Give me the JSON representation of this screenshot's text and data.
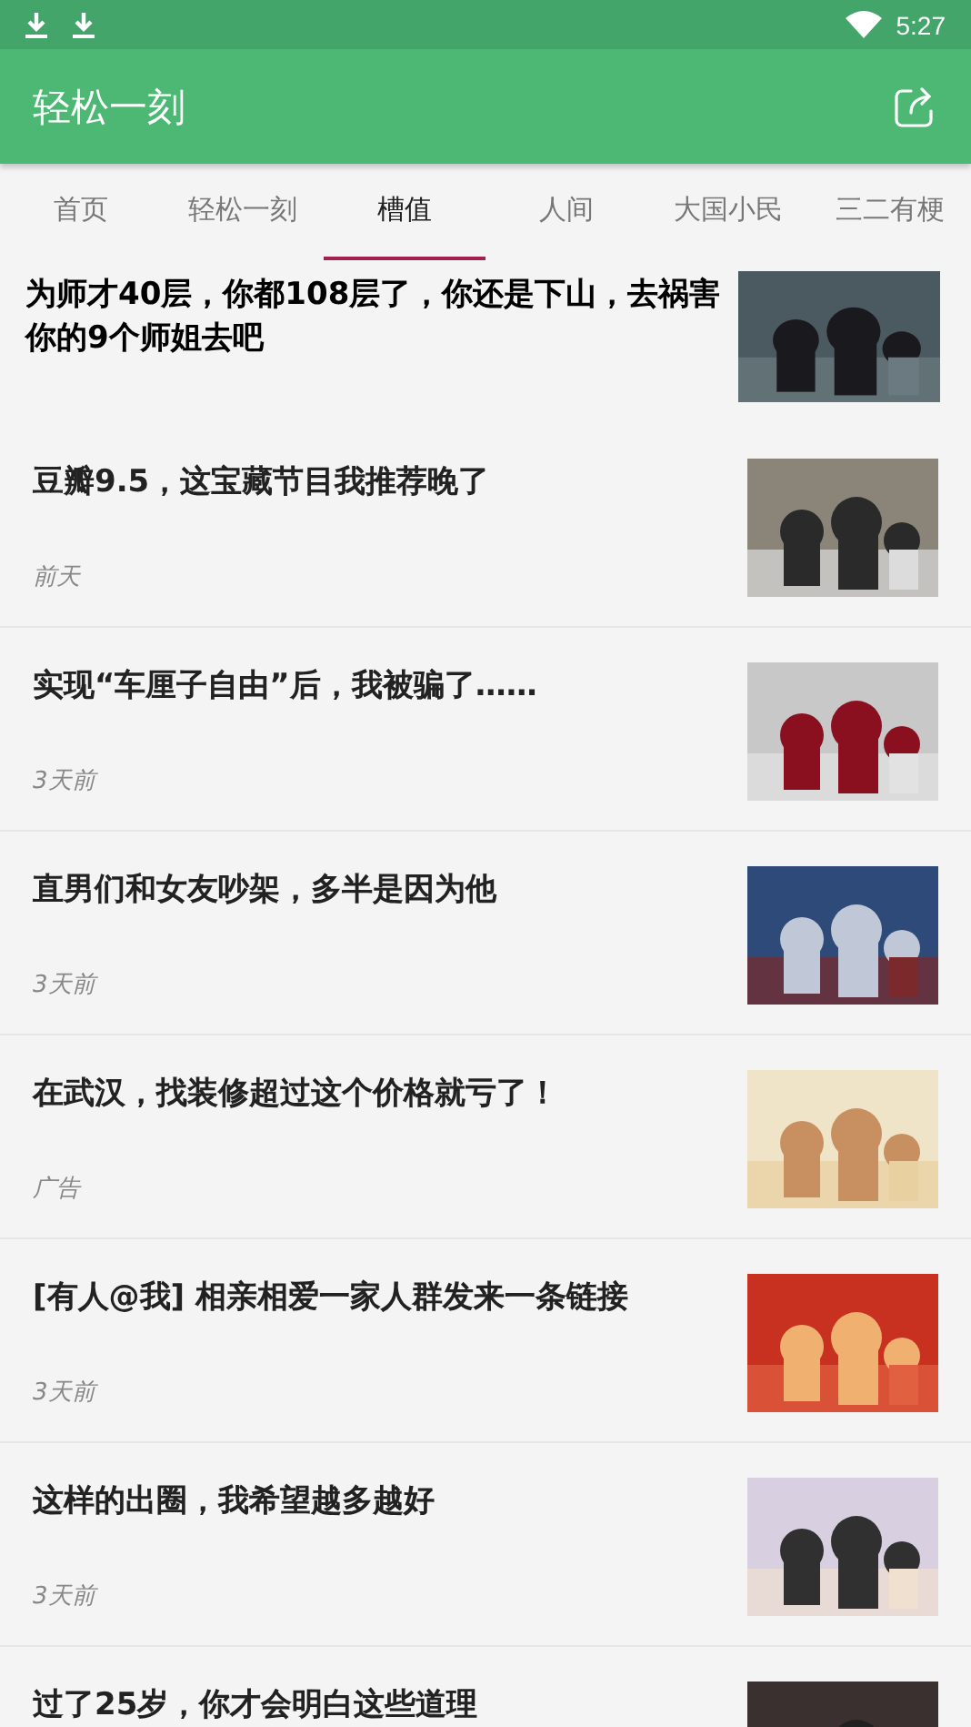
{
  "status_bar": {
    "time": "5:27",
    "notifications": [
      {
        "kind": "download"
      },
      {
        "kind": "download"
      }
    ]
  },
  "app_bar": {
    "title": "轻松一刻"
  },
  "tabs": [
    {
      "label": "首页",
      "selected": false
    },
    {
      "label": "轻松一刻",
      "selected": false
    },
    {
      "label": "槽值",
      "selected": true
    },
    {
      "label": "人间",
      "selected": false
    },
    {
      "label": "大国小民",
      "selected": false
    },
    {
      "label": "三二有梗",
      "selected": false
    }
  ],
  "articles": [
    {
      "title": "为师才40层，你都108层了，你还是下山，去祸害你的9个师姐去吧",
      "featured": true
    },
    {
      "title": "豆瓣9.5，这宝藏节目我推荐晚了",
      "time": "前天",
      "featured": false
    },
    {
      "title": "实现“车厘子自由”后，我被骗了……",
      "time": "3天前",
      "featured": false
    },
    {
      "title": "直男们和女友吵架，多半是因为他",
      "time": "3天前",
      "featured": false
    },
    {
      "title": "在武汉，找装修超过这个价格就亏了！",
      "time": "广告",
      "featured": false
    },
    {
      "title": "[有人@我] 相亲相爱一家人群发来一条链接",
      "time": "3天前",
      "featured": false
    },
    {
      "title": "这样的出圈，我希望越多越好",
      "time": "3天前",
      "featured": false
    },
    {
      "title": "过了25岁，你才会明白这些道理",
      "featured": false
    }
  ]
}
